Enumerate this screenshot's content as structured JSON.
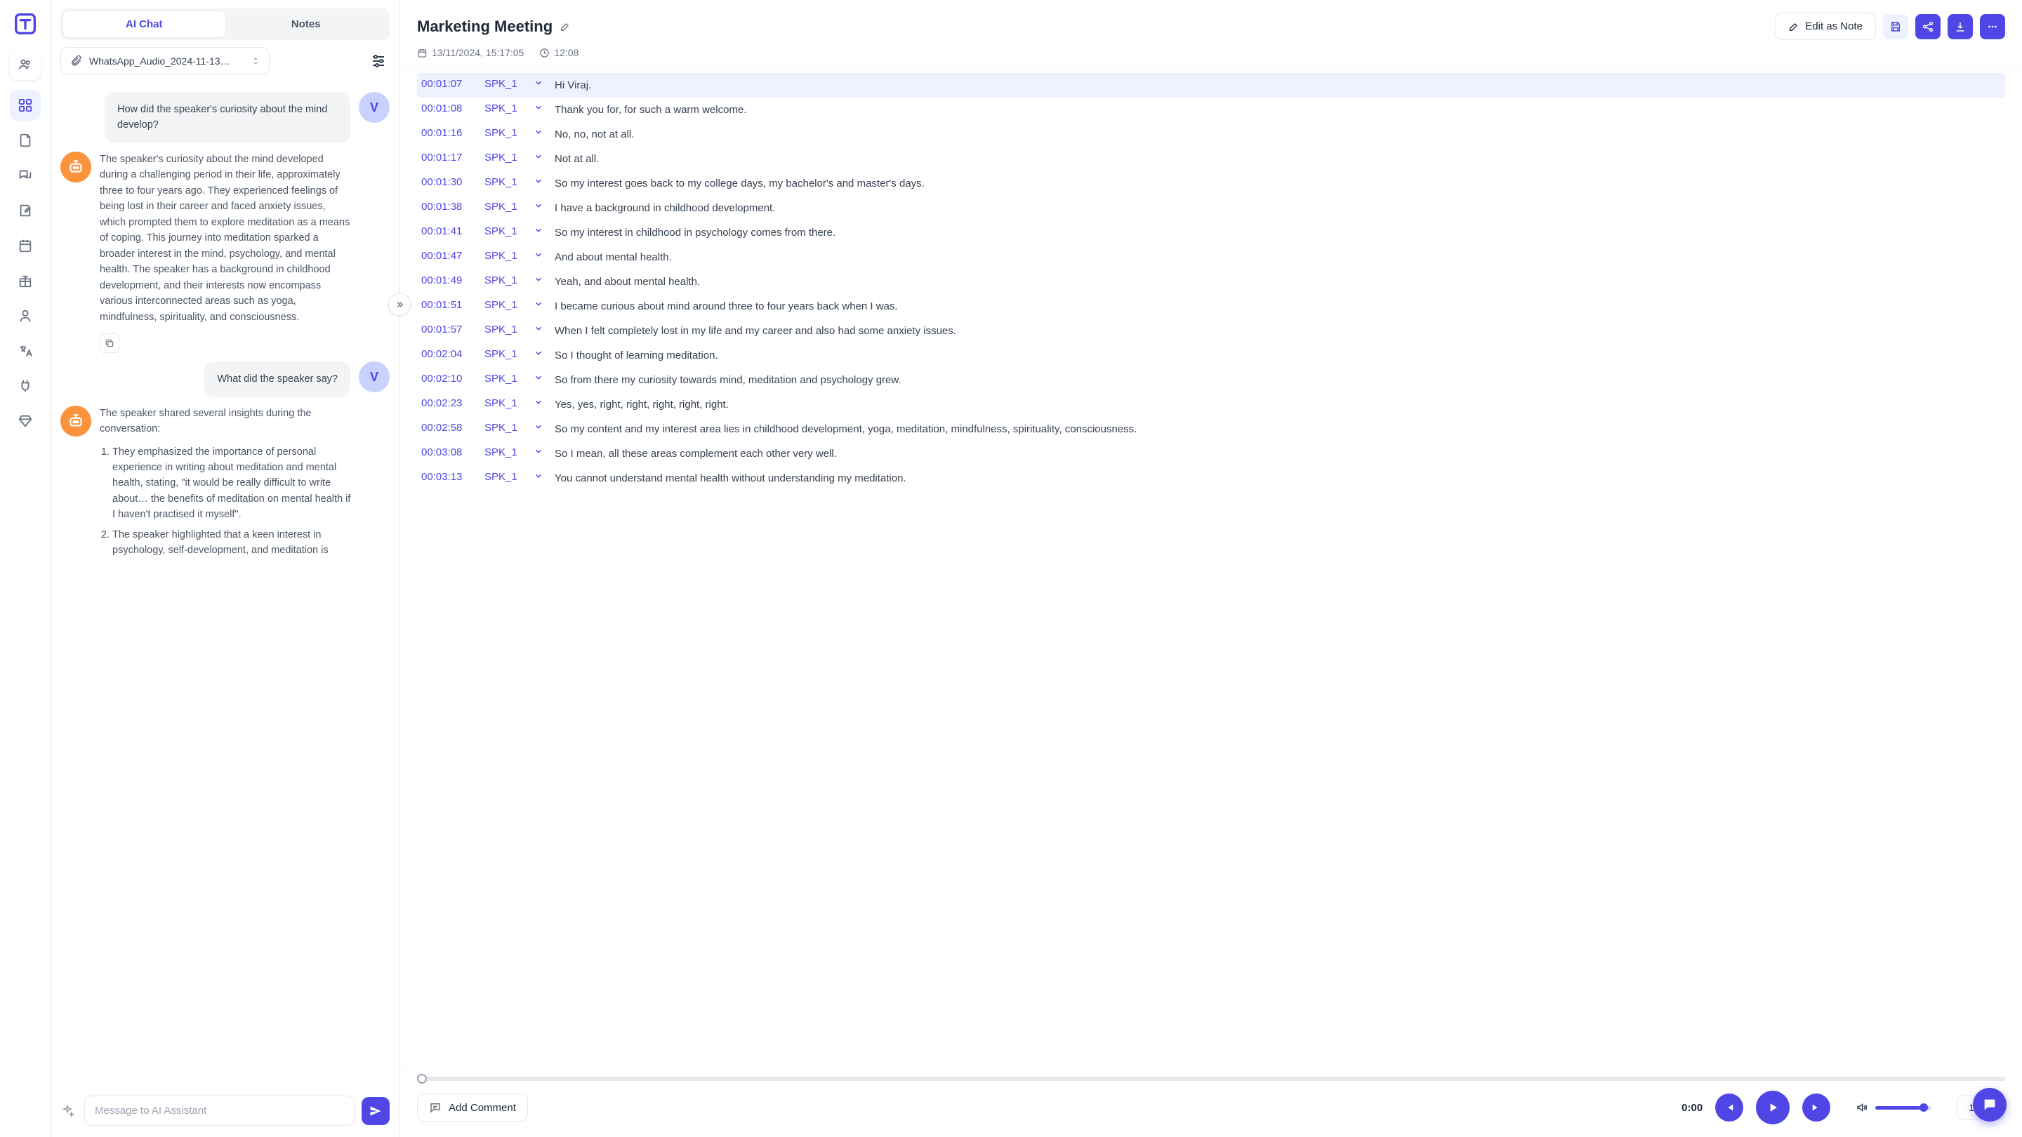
{
  "rail": {
    "nav_items": [
      "dashboard",
      "documents",
      "chat",
      "notes",
      "calendar",
      "gift",
      "profile",
      "translate",
      "plug",
      "diamond"
    ]
  },
  "left": {
    "tabs": {
      "ai_chat": "AI Chat",
      "notes": "Notes"
    },
    "file_name": "WhatsApp_Audio_2024-11-13…",
    "user_initial": "V",
    "messages": {
      "u1": "How did the speaker's curiosity about the mind develop?",
      "b1": "The speaker's curiosity about the mind developed during a challenging period in their life, approximately three to four years ago. They experienced feelings of being lost in their career and faced anxiety issues, which prompted them to explore meditation as a means of coping. This journey into meditation sparked a broader interest in the mind, psychology, and mental health. The speaker has a background in childhood development, and their interests now encompass various interconnected areas such as yoga, mindfulness, spirituality, and consciousness.",
      "u2": "What did the speaker say?",
      "b2_intro": "The speaker shared several insights during the conversation:",
      "b2_items": [
        "They emphasized the importance of personal experience in writing about meditation and mental health, stating, \"it would be really difficult to write about… the benefits of meditation on mental health if I haven't practised it myself\".",
        "The speaker highlighted that a keen interest in psychology, self-development, and meditation is"
      ]
    },
    "compose_placeholder": "Message to AI Assistant"
  },
  "header": {
    "title": "Marketing Meeting",
    "date": "13/11/2024, 15:17:05",
    "duration": "12:08",
    "edit_note": "Edit as Note"
  },
  "transcript": [
    {
      "ts": "00:01:07",
      "spk": "SPK_1",
      "txt": "Hi Viraj."
    },
    {
      "ts": "00:01:08",
      "spk": "SPK_1",
      "txt": "Thank you for, for such a warm welcome."
    },
    {
      "ts": "00:01:16",
      "spk": "SPK_1",
      "txt": "No, no, not at all."
    },
    {
      "ts": "00:01:17",
      "spk": "SPK_1",
      "txt": "Not at all."
    },
    {
      "ts": "00:01:30",
      "spk": "SPK_1",
      "txt": "So my interest goes back to my college days, my bachelor's and master's days."
    },
    {
      "ts": "00:01:38",
      "spk": "SPK_1",
      "txt": "I have a background in childhood development."
    },
    {
      "ts": "00:01:41",
      "spk": "SPK_1",
      "txt": "So my interest in childhood in psychology comes from there."
    },
    {
      "ts": "00:01:47",
      "spk": "SPK_1",
      "txt": "And about mental health."
    },
    {
      "ts": "00:01:49",
      "spk": "SPK_1",
      "txt": "Yeah, and about mental health."
    },
    {
      "ts": "00:01:51",
      "spk": "SPK_1",
      "txt": "I became curious about mind around three to four years back when I was."
    },
    {
      "ts": "00:01:57",
      "spk": "SPK_1",
      "txt": "When I felt completely lost in my life and my career and also had some anxiety issues."
    },
    {
      "ts": "00:02:04",
      "spk": "SPK_1",
      "txt": "So I thought of learning meditation."
    },
    {
      "ts": "00:02:10",
      "spk": "SPK_1",
      "txt": "So from there my curiosity towards mind, meditation and psychology grew."
    },
    {
      "ts": "00:02:23",
      "spk": "SPK_1",
      "txt": "Yes, yes, right, right, right, right, right."
    },
    {
      "ts": "00:02:58",
      "spk": "SPK_1",
      "txt": "So my content and my interest area lies in childhood development, yoga, meditation, mindfulness, spirituality, consciousness."
    },
    {
      "ts": "00:03:08",
      "spk": "SPK_1",
      "txt": "So I mean, all these areas complement each other very well."
    },
    {
      "ts": "00:03:13",
      "spk": "SPK_1",
      "txt": "You cannot understand mental health without understanding my meditation."
    }
  ],
  "player": {
    "add_comment": "Add Comment",
    "time": "0:00",
    "speed": "1x"
  }
}
